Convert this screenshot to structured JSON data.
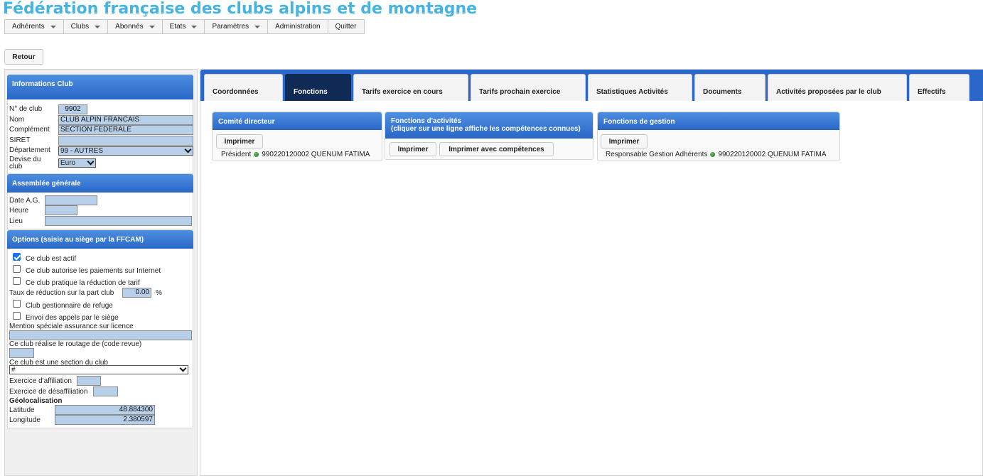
{
  "header": {
    "title": "Fédération française des clubs alpins et de montagne"
  },
  "menu": [
    {
      "label": "Adhérents",
      "dropdown": true
    },
    {
      "label": "Clubs",
      "dropdown": true
    },
    {
      "label": "Abonnés",
      "dropdown": true
    },
    {
      "label": "Etats",
      "dropdown": true
    },
    {
      "label": "Paramètres",
      "dropdown": true
    },
    {
      "label": "Administration",
      "dropdown": false
    },
    {
      "label": "Quitter",
      "dropdown": false
    }
  ],
  "retour_label": "Retour",
  "info_club": {
    "heading": "Informations Club",
    "numero_label": "N° de club",
    "numero": "9902",
    "nom_label": "Nom",
    "nom": "CLUB ALPIN FRANCAIS",
    "complement_label": "Complément",
    "complement": "SECTION FEDERALE",
    "siret_label": "SIRET",
    "siret": "",
    "departement_label": "Département",
    "departement": "99 - AUTRES",
    "devise_label_1": "Devise du",
    "devise_label_2": "club",
    "devise": "Euro"
  },
  "assemblee": {
    "heading": "Assemblée générale",
    "date_label": "Date A.G.",
    "date": "",
    "heure_label": "Heure",
    "heure": "",
    "lieu_label": "Lieu",
    "lieu": ""
  },
  "options": {
    "heading": "Options (saisie au siège par la FFCAM)",
    "actif_label": "Ce club est actif",
    "actif": true,
    "paiements_label": "Ce club autorise les paiements sur Internet",
    "paiements": false,
    "reduction_label": "Ce club pratique la réduction de tarif",
    "reduction": false,
    "taux_label": "Taux de réduction sur la part club",
    "taux": "0.00",
    "taux_unit": "%",
    "refuge_label": "Club gestionnaire de refuge",
    "refuge": false,
    "envoi_label": "Envoi des appels par le siège",
    "envoi": false,
    "mention_label": "Mention spéciale assurance sur licence",
    "mention": "",
    "routage_label": "Ce club réalise le routage de (code revue)",
    "routage": "",
    "section_label": "Ce club est une section du club",
    "section": "#",
    "affiliation_label": "Exercice d'affiliation",
    "affiliation": "",
    "desaffiliation_label": "Exercice de désaffiliation",
    "desaffiliation": "",
    "geo_label": "Géolocalisation",
    "latitude_label": "Latitude",
    "latitude": "48.884300",
    "longitude_label": "Longitude",
    "longitude": "2.380597"
  },
  "tabs": [
    {
      "label": "Coordonnées",
      "active": false
    },
    {
      "label": "Fonctions",
      "active": true
    },
    {
      "label": "Tarifs exercice en cours",
      "active": false
    },
    {
      "label": "Tarifs prochain exercice",
      "active": false
    },
    {
      "label": "Statistiques Activités",
      "active": false
    },
    {
      "label": "Documents",
      "active": false
    },
    {
      "label": "Activités proposées par le club",
      "active": false
    },
    {
      "label": "Effectifs",
      "active": false
    }
  ],
  "comite": {
    "heading": "Comité directeur",
    "print_label": "Imprimer",
    "role": "Président",
    "person": "990220120002 QUENUM FATIMA"
  },
  "fonctions_activites": {
    "heading_1": "Fonctions d'activités",
    "heading_2": "(cliquer sur une ligne affiche les compétences connues)",
    "print_label": "Imprimer",
    "print_comp_label": "Imprimer avec compétences"
  },
  "fonctions_gestion": {
    "heading": "Fonctions de gestion",
    "print_label": "Imprimer",
    "role": "Responsable Gestion Adhérents",
    "person": "990220120002 QUENUM FATIMA"
  },
  "colors": {
    "title": "#46b3e0",
    "header_blue": "#2a67c8",
    "active_tab": "#0f2a55",
    "field_bg": "#b7cfe8",
    "status_green": "#2e8b2e"
  }
}
